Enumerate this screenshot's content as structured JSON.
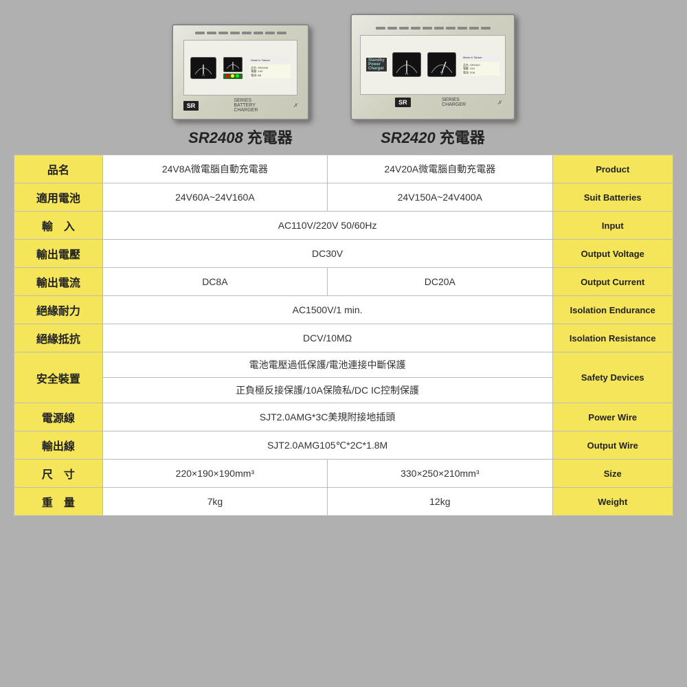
{
  "background_color": "#b0b0b0",
  "products": [
    {
      "id": "sr2408",
      "model": "SR2408",
      "suffix": " 充電器"
    },
    {
      "id": "sr2420",
      "model": "SR2420",
      "suffix": " 充電器"
    }
  ],
  "table": {
    "headers": {
      "label_col": "",
      "sr2408_col": "SR2408",
      "sr2420_col": "SR2420",
      "en_col": ""
    },
    "rows": [
      {
        "label": "品名",
        "sr2408": "24V8A微電腦自動充電器",
        "sr2420": "24V20A微電腦自動充電器",
        "en": "Product",
        "combined": false
      },
      {
        "label": "適用電池",
        "sr2408": "24V60A~24V160A",
        "sr2420": "24V150A~24V400A",
        "en": "Suit Batteries",
        "combined": false
      },
      {
        "label": "輸　入",
        "combined": true,
        "combined_value": "AC110V/220V  50/60Hz",
        "en": "Input"
      },
      {
        "label": "輸出電壓",
        "combined": true,
        "combined_value": "DC30V",
        "en": "Output Voltage"
      },
      {
        "label": "輸出電流",
        "sr2408": "DC8A",
        "sr2420": "DC20A",
        "en": "Output Current",
        "combined": false
      },
      {
        "label": "絕緣耐力",
        "combined": true,
        "combined_value": "AC1500V/1 min.",
        "en": "Isolation Endurance"
      },
      {
        "label": "絕緣抵抗",
        "combined": true,
        "combined_value": "DCV/10MΩ",
        "en": "Isolation Resistance"
      },
      {
        "label": "安全裝置",
        "combined": true,
        "combined_value": "電池電壓過低保護/電池連接中斷保護",
        "en": "Safety Devices",
        "has_second_line": true,
        "second_line": "正負極反接保護/10A保險私/DC  IC控制保護"
      },
      {
        "label": "電源線",
        "combined": true,
        "combined_value": "SJT2.0AMG*3C美規附接地插頭",
        "en": "Power Wire"
      },
      {
        "label": "輸出線",
        "combined": true,
        "combined_value": "SJT2.0AMG105℃*2C*1.8M",
        "en": "Output Wire"
      },
      {
        "label": "尺　寸",
        "sr2408": "220×190×190mm³",
        "sr2420": "330×250×210mm³",
        "en": "Size",
        "combined": false
      },
      {
        "label": "重　量",
        "sr2408": "7kg",
        "sr2420": "12kg",
        "en": "Weight",
        "combined": false
      }
    ]
  }
}
